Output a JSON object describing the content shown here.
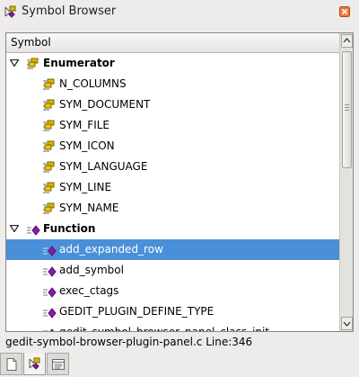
{
  "window": {
    "title": "Symbol Browser",
    "icons": {
      "title": "symbol-browser-icon",
      "close": "close-icon"
    }
  },
  "tree": {
    "column_header": "Symbol",
    "groups": [
      {
        "label": "Enumerator",
        "expanded": true,
        "icon": "enumerator-icon",
        "items": [
          "N_COLUMNS",
          "SYM_DOCUMENT",
          "SYM_FILE",
          "SYM_ICON",
          "SYM_LANGUAGE",
          "SYM_LINE",
          "SYM_NAME"
        ]
      },
      {
        "label": "Function",
        "expanded": true,
        "icon": "function-icon",
        "items": [
          "add_expanded_row",
          "add_symbol",
          "exec_ctags",
          "GEDIT_PLUGIN_DEFINE_TYPE",
          "gedit_symbol_browser_panel_class_init"
        ]
      }
    ],
    "selected_item": "add_expanded_row"
  },
  "status": {
    "text": "gedit-symbol-browser-plugin-panel.c Line:346"
  },
  "tabs": [
    {
      "icon": "document-icon",
      "active": false
    },
    {
      "icon": "symbol-browser-icon",
      "active": true
    },
    {
      "icon": "file-browser-icon",
      "active": false
    }
  ],
  "colors": {
    "selection": "#4a90d9",
    "enumerator_icon": "#c8a300",
    "function_icon": "#8a1bb0",
    "close_button": "#e8611d"
  }
}
